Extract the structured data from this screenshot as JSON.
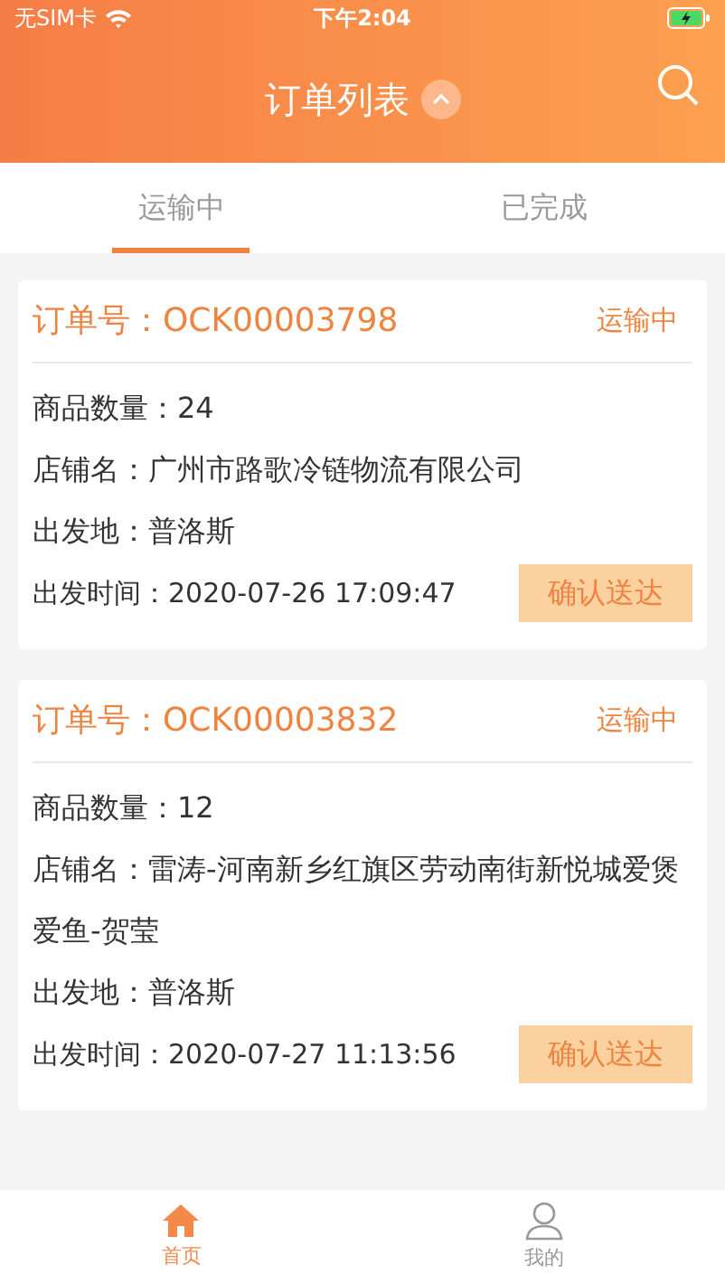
{
  "status_bar": {
    "carrier": "无SIM卡",
    "time": "下午2:04"
  },
  "header": {
    "title": "订单列表"
  },
  "tabs": [
    {
      "label": "运输中",
      "selected": true
    },
    {
      "label": "已完成",
      "selected": false
    }
  ],
  "orders": [
    {
      "order_no": "订单号：OCK00003798",
      "status": "运输中",
      "fields": [
        "商品数量：24",
        "店铺名：广州市路歌冷链物流有限公司",
        "出发地：普洛斯"
      ],
      "departure": "出发时间：2020-07-26 17:09:47",
      "action": "确认送达"
    },
    {
      "order_no": "订单号：OCK00003832",
      "status": "运输中",
      "fields": [
        "商品数量：12",
        "店铺名：雷涛-河南新乡红旗区劳动南街新悦城爱煲爱鱼-贺莹",
        "出发地：普洛斯"
      ],
      "departure": "出发时间：2020-07-27 11:13:56",
      "action": "确认送达"
    }
  ],
  "bottom_nav": [
    {
      "label": "首页",
      "kind": "home",
      "selected": true
    },
    {
      "label": "我的",
      "kind": "profile",
      "selected": false
    }
  ]
}
